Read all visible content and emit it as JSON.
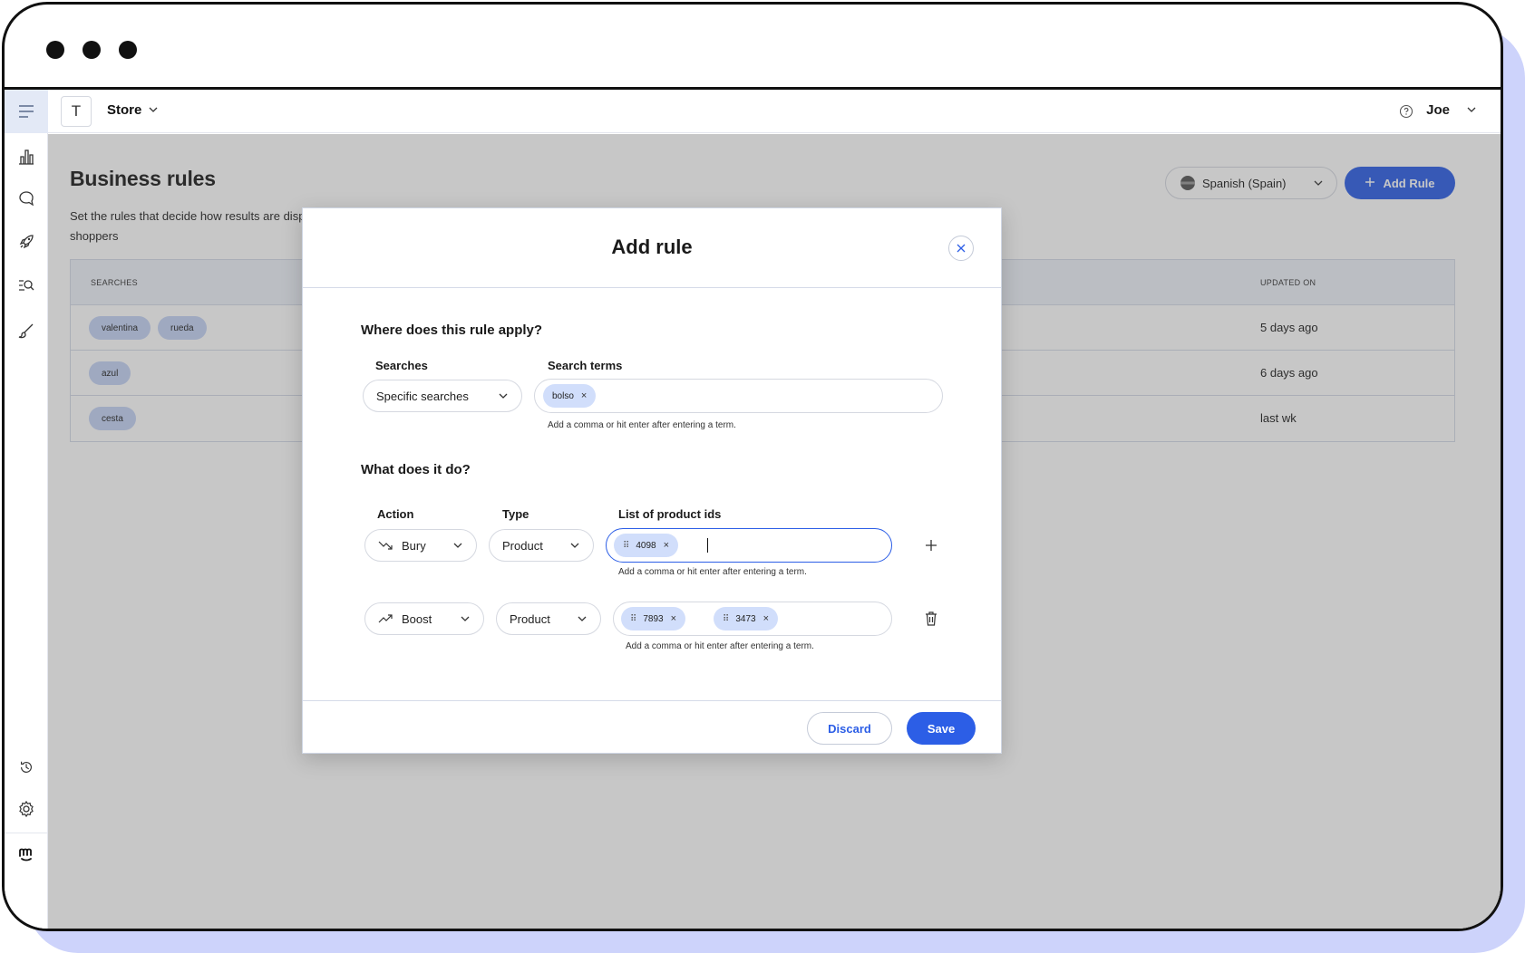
{
  "topbar": {
    "store_initial": "T",
    "store_name": "Store",
    "user_name": "Joe"
  },
  "page": {
    "title": "Business rules",
    "subtitle": "Set the rules that decide how results are displayed to shoppers",
    "language": "Spanish (Spain)",
    "add_rule_label": "Add Rule"
  },
  "table": {
    "headers": {
      "searches": "SEARCHES",
      "updated_on": "UPDATED ON"
    },
    "rows": [
      {
        "searches": [
          "valentina",
          "rueda"
        ],
        "updated_on": "5 days ago"
      },
      {
        "searches": [
          "azul"
        ],
        "updated_on": "6 days ago"
      },
      {
        "searches": [
          "cesta"
        ],
        "updated_on": "last wk"
      }
    ]
  },
  "modal": {
    "title": "Add rule",
    "where_title": "Where does this rule apply?",
    "searches_label": "Searches",
    "searches_value": "Specific searches",
    "search_terms_label": "Search terms",
    "search_terms": [
      "bolso"
    ],
    "terms_hint": "Add a comma or hit enter after entering a term.",
    "what_title": "What does it do?",
    "action_label": "Action",
    "type_label": "Type",
    "ids_label": "List of product ids",
    "rules": [
      {
        "action": "Bury",
        "action_icon": "trend-down-icon",
        "type": "Product",
        "ids": [
          "4098"
        ],
        "hint": "Add a comma or hit enter after entering a term.",
        "row_button": "add-icon"
      },
      {
        "action": "Boost",
        "action_icon": "trend-up-icon",
        "type": "Product",
        "ids": [
          "7893",
          "3473"
        ],
        "hint": "Add a comma or hit enter after entering a term.",
        "row_button": "trash-icon"
      }
    ],
    "discard_label": "Discard",
    "save_label": "Save"
  },
  "colors": {
    "accent": "#2c5ee6",
    "chip": "#c4d3f5",
    "tag": "#d1defb",
    "overlay": "rgba(80,80,80,0.32)"
  }
}
